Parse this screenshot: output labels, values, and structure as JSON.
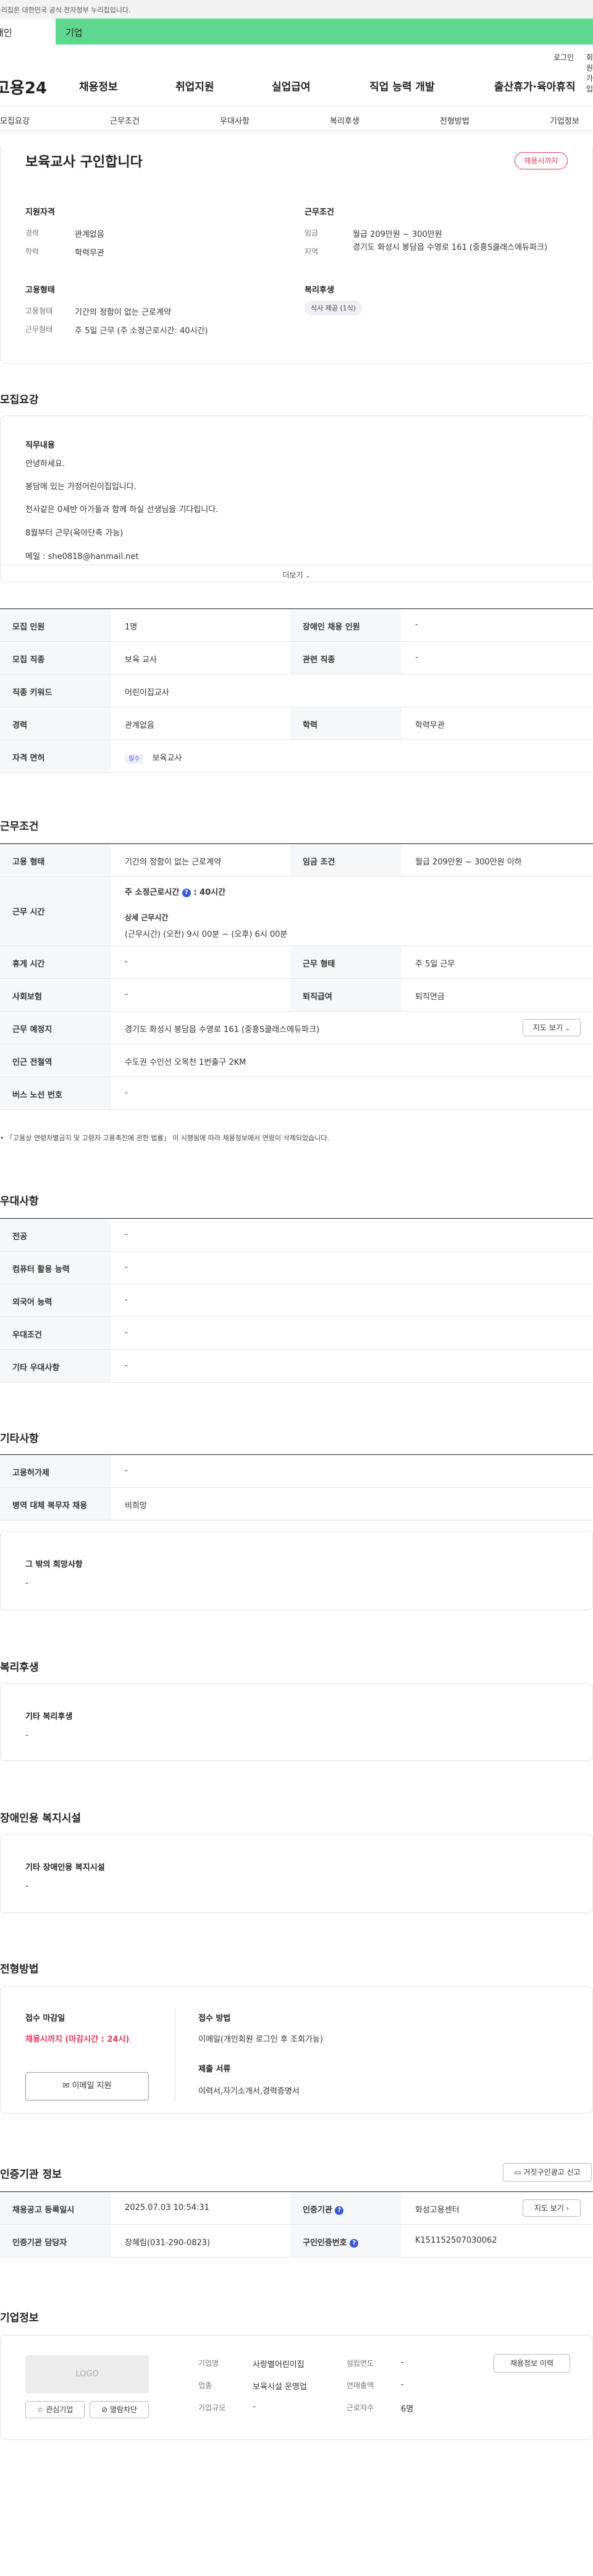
{
  "top_notice": "이 누리집은 대한민국 공식 전자정부 누리집입니다.",
  "org_tabs": [
    "개인",
    "기업"
  ],
  "utility_links": [
    "로그인",
    "회원가입"
  ],
  "logo": "고용24",
  "main_nav": [
    "채용정보",
    "취업지원",
    "실업급여",
    "직업 능력 개발",
    "출산휴가·육아휴직"
  ],
  "sub_nav": [
    "모집요강",
    "근무조건",
    "우대사항",
    "복리후생",
    "전형방법",
    "기업정보"
  ],
  "summary": {
    "title": "보육교사 구인합니다",
    "deadline_badge": "채용시까지",
    "qualification_heading": "지원자격",
    "qualification": [
      {
        "label": "경력",
        "value": "관계없음"
      },
      {
        "label": "학력",
        "value": "학력무관"
      }
    ],
    "employment_heading": "고용형태",
    "employment": [
      {
        "label": "고용형태",
        "value": "기간의 정함이 없는 근로계약"
      },
      {
        "label": "근무형태",
        "value": "주 5일 근무 (주 소정근로시간: 40시간)"
      }
    ],
    "conditions_heading": "근무조건",
    "conditions": [
      {
        "label": "임금",
        "value": "월급 209만원 ~ 300만원"
      },
      {
        "label": "지역",
        "value": "경기도 화성시 봉담읍 수영로 161 (중흥S클래스에듀파크)"
      }
    ],
    "welfare_heading": "복리후생",
    "welfare_chip": "식사 제공 (1식)"
  },
  "recruit": {
    "title": "모집요강",
    "duty_heading": "직무내용",
    "duty_lines": [
      "안녕하세요.",
      "봉담에 있는 가정어린이집입니다.",
      "천사같은 0세반 아가들과 함께 하실 선생님을 기다립니다.",
      "8월부터 근무(육아단축 가능)",
      "메일 : she0818@hanmail.net"
    ],
    "more_label": "더보기",
    "rows": [
      {
        "l1": "모집 인원",
        "v1": "1명",
        "l2": "장애인 채용 인원",
        "v2": "-"
      },
      {
        "l1": "모집 직종",
        "v1": "보육 교사",
        "l2": "관련 직종",
        "v2": "-"
      }
    ],
    "keyword_label": "직종 키워드",
    "keyword_value": "어린이집교사",
    "edu_row": {
      "l1": "경력",
      "v1": "관계없음",
      "l2": "학력",
      "v2": "학력무관"
    },
    "license_label": "자격 면허",
    "license_badge": "필수",
    "license_value": "보육교사"
  },
  "work": {
    "title": "근무조건",
    "emp_type_label": "고용 형태",
    "emp_type_value": "기간의 정함이 없는 근로계약",
    "wage_label": "임금 조건",
    "wage_value": "월급 209만원 ~ 300만원 이하",
    "hours_label": "근무 시간",
    "hours_weekly": "주 소정근로시간",
    "hours_weekly_value": ": 40시간",
    "hours_detail_heading": "상세 근무시간",
    "hours_detail": "(근무시간) (오전) 9시 00분 ~ (오후) 6시 00분",
    "rows": [
      {
        "l1": "휴게 시간",
        "v1": "-",
        "l2": "근무 형태",
        "v2": "주 5일 근무"
      },
      {
        "l1": "사회보험",
        "v1": "-",
        "l2": "퇴직급여",
        "v2": "퇴직연금"
      }
    ],
    "location_label": "근무 예정지",
    "location_value": "경기도 화성시 봉담읍 수영로 161 (중흥S클래스에듀파크)",
    "map_button": "지도 보기",
    "subway_label": "인근 전철역",
    "subway_value": "수도권 수인선 오목천 1번출구 2KM",
    "bus_label": "버스 노선 번호",
    "bus_value": "-",
    "footnote": "「고용상 연령차별금지 및 고령자 고용촉진에 관한 법률」 이 시행됨에 따라 채용정보에서 연령이 삭제되었습니다."
  },
  "prefer": {
    "title": "우대사항",
    "rows": [
      {
        "label": "전공",
        "value": "-"
      },
      {
        "label": "컴퓨터 활용 능력",
        "value": "-"
      },
      {
        "label": "외국어 능력",
        "value": "-"
      },
      {
        "label": "우대조건",
        "value": "-"
      },
      {
        "label": "기타 우대사항",
        "value": "-"
      }
    ]
  },
  "etc": {
    "title": "기타사항",
    "rows": [
      {
        "label": "고용허가제",
        "value": "-"
      },
      {
        "label": "병역 대체 복무자 채용",
        "value": "비희망"
      }
    ],
    "other_heading": "그 밖의 희망사항",
    "other_value": "-"
  },
  "welfare": {
    "title": "복리후생",
    "heading": "기타 복리후생",
    "value": "-"
  },
  "disability": {
    "title": "장애인용 복지시설",
    "heading": "기타 장애인용 복지시설",
    "value": "-"
  },
  "selection": {
    "title": "전형방법",
    "deadline_heading": "접수 마감일",
    "deadline_value": "채용시까지 (마감시간 : 24시)",
    "email_button": "이메일 지원",
    "method_heading": "접수 방법",
    "method_value": "이메일(개인회원 로그인 후 조회가능)",
    "docs_heading": "제출 서류",
    "docs_value": "이력서,자기소개서,경력증명서"
  },
  "cert": {
    "title": "인증기관 정보",
    "report_button": "거짓구인광고 신고",
    "rows": [
      {
        "l1": "채용공고 등록일시",
        "v1": "2025.07.03 10:54:31",
        "l2": "인증기관",
        "v2": "화성고용센터"
      },
      {
        "l1": "인증기관 담당자",
        "v1": "장혜림(031-290-0823)",
        "l2": "구인인증번호",
        "v2": "K151152507030062"
      }
    ],
    "map_button": "지도 보기"
  },
  "company": {
    "title": "기업정보",
    "logo_placeholder": "LOGO",
    "fav_button": "관심기업",
    "block_button": "열람차단",
    "history_button": "채용정보 이력",
    "fields": [
      {
        "label": "기업명",
        "value": "사랑별어린이집"
      },
      {
        "label": "업종",
        "value": "보육시설 운영업"
      },
      {
        "label": "기업규모",
        "value": "-"
      }
    ],
    "fields2": [
      {
        "label": "설립연도",
        "value": "-"
      },
      {
        "label": "연매출액",
        "value": "-"
      },
      {
        "label": "근로자수",
        "value": "6명"
      }
    ]
  },
  "colors": {
    "accent_green": "#5ed88f",
    "deadline_red": "#e8385a",
    "info_blue": "#3a5bd9"
  }
}
